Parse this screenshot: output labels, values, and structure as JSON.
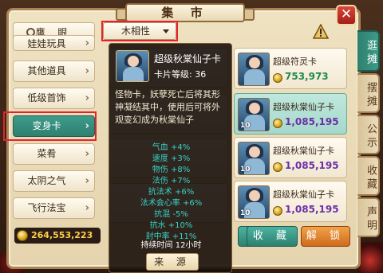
{
  "header": {
    "title": "集 市"
  },
  "side_tabs": [
    {
      "label": "逛摊",
      "active": true
    },
    {
      "label": "摆摊",
      "active": false
    },
    {
      "label": "公示",
      "active": false
    },
    {
      "label": "收藏",
      "active": false
    },
    {
      "label": "声明",
      "active": false
    }
  ],
  "categories": {
    "search_label": "鹰 眼",
    "items": [
      {
        "label": "娃娃玩具",
        "active": false
      },
      {
        "label": "其他道具",
        "active": false
      },
      {
        "label": "低级首饰",
        "active": false
      },
      {
        "label": "变身卡",
        "active": true
      },
      {
        "label": "菜肴",
        "active": false
      },
      {
        "label": "太阴之气",
        "active": false
      },
      {
        "label": "飞行法宝",
        "active": false
      }
    ]
  },
  "filter": {
    "selected": "木相性"
  },
  "wallet": {
    "amount": "264,553,223"
  },
  "items": [
    {
      "name": "超级符灵卡",
      "price": "753,973",
      "quantity": "",
      "price_color": "green",
      "active": false
    },
    {
      "name": "超级秋棠仙子卡",
      "price": "1,085,195",
      "quantity": "10",
      "price_color": "purple",
      "active": true
    },
    {
      "name": "超级秋棠仙子卡",
      "price": "1,085,195",
      "quantity": "10",
      "price_color": "purple",
      "active": false
    },
    {
      "name": "超级秋棠仙子卡",
      "price": "1,085,195",
      "quantity": "10",
      "price_color": "purple",
      "active": false
    }
  ],
  "buttons": {
    "favorite": "收 藏",
    "unlock": "解 锁"
  },
  "tooltip": {
    "title": "超级秋棠仙子卡",
    "level": "卡片等级: 36",
    "description": "怪物卡，妖孽死亡后将其形神凝结其中，使用后可将外观变幻成为秋棠仙子",
    "stats": [
      "气血 +4%",
      "速度 +3%",
      "物伤 +8%",
      "法伤 +7%",
      "抗法术 +6%",
      "法术会心率 +6%",
      "抗混 -5%",
      "抗水 +10%",
      "封中率 +11%"
    ],
    "duration": "持续时间 12小时",
    "source_button": "来 源"
  },
  "colors": {
    "accent_teal": "#2e8070",
    "close_red": "#c42a22",
    "price_purple": "#6b2fa8",
    "price_green": "#1e8a4e",
    "stat_cyan": "#38d3c7",
    "money_gold": "#ffcf4a"
  }
}
